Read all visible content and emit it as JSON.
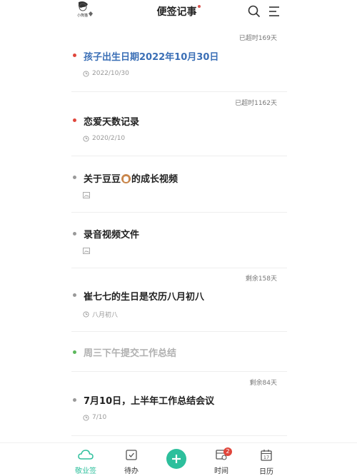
{
  "header": {
    "avatar_label": "小熊猫",
    "title": "便签记事"
  },
  "notes": [
    {
      "badge": "已超时169天",
      "title": "孩子出生日期2022年10月30日",
      "meta": "2022/10/30",
      "dot": "#e0463c",
      "title_color": "#3b6fb6"
    },
    {
      "badge": "已超时1162天",
      "title": "恋爱天数记录",
      "meta": "2020/2/10",
      "dot": "#e0463c",
      "title_color": "#222222"
    },
    {
      "title_before": "关于豆豆",
      "title_after": "的成长视频",
      "dot": "#999999",
      "title_color": "#222222"
    },
    {
      "title": "录音视频文件",
      "dot": "#999999",
      "title_color": "#222222"
    },
    {
      "badge": "剩余158天",
      "title": "崔七七的生日是农历八月初八",
      "meta": "八月初八",
      "dot": "#999999",
      "title_color": "#222222"
    },
    {
      "title": "周三下午提交工作总结",
      "dot": "#5cb85c",
      "title_color": "#b0b0b0"
    },
    {
      "badge": "剩余84天",
      "title": "7月10日，上半年工作总结会议",
      "meta": "7/10",
      "dot": "#999999",
      "title_color": "#222222"
    }
  ],
  "tabs": {
    "notes_label": "敬业签",
    "todo_label": "待办",
    "time_label": "时间",
    "time_badge": "2",
    "calendar_label": "日历",
    "calendar_day": "17"
  },
  "colors": {
    "accent": "#2dbf9c",
    "overdue": "#e0463c"
  }
}
